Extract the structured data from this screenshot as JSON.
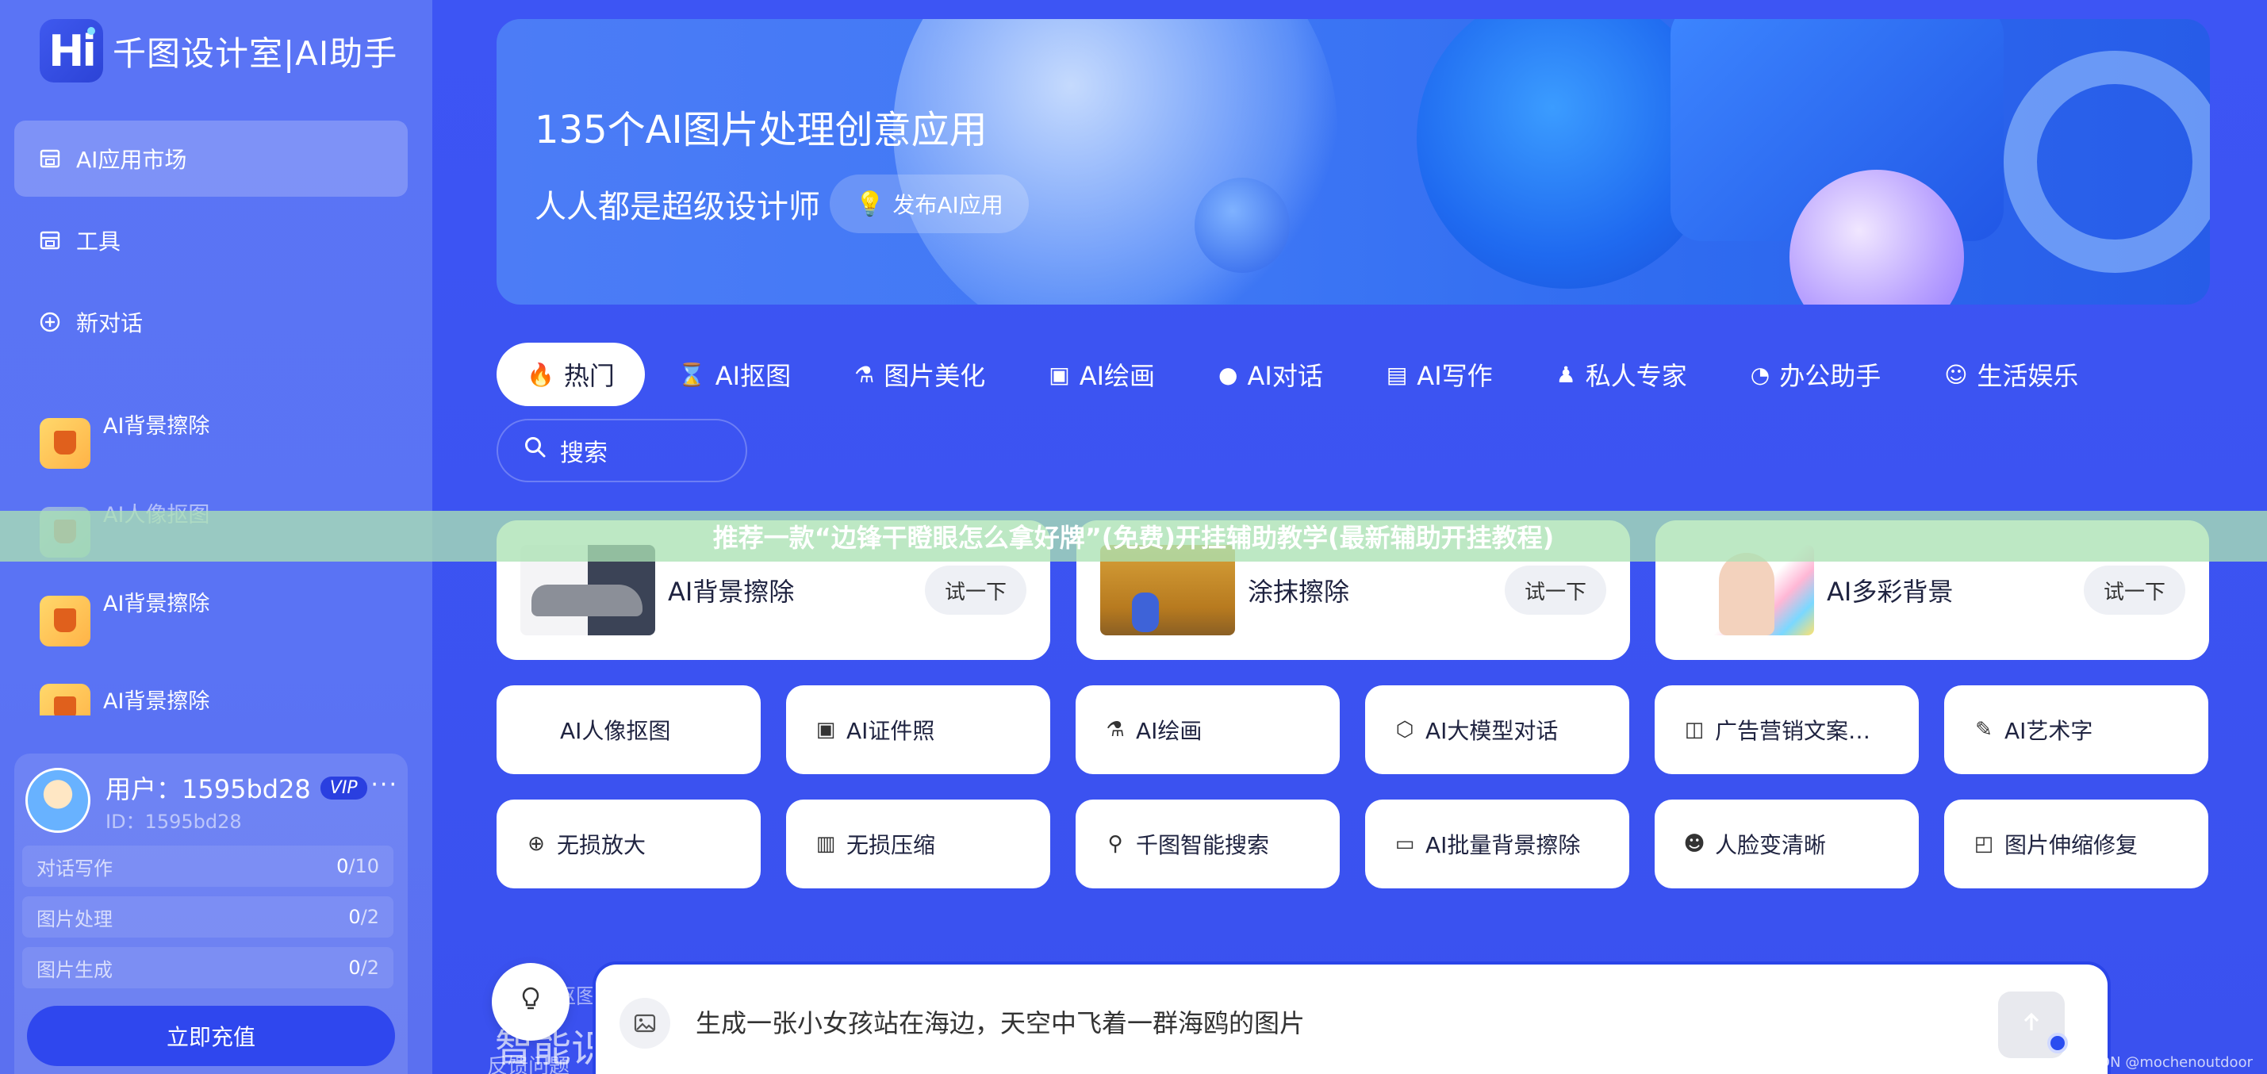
{
  "app": {
    "logo_mark": "Hi",
    "logo_text": "千图设计室|AI助手"
  },
  "sidebar": {
    "nav": [
      {
        "label": "AI应用市场",
        "icon": "store-icon",
        "active": true
      },
      {
        "label": "工具",
        "icon": "store-icon",
        "active": false
      },
      {
        "label": "新对话",
        "icon": "plus-circle-icon",
        "active": false
      }
    ],
    "recent": [
      {
        "label": "AI背景擦除"
      },
      {
        "label": "AI人像抠图"
      },
      {
        "label": "AI背景擦除"
      },
      {
        "label": "AI背景擦除"
      }
    ]
  },
  "user": {
    "name": "用户：1595bd28",
    "vip": "VIP",
    "more": "···",
    "id": "ID：1595bd28",
    "quotas": [
      {
        "label": "对话写作",
        "used": "0",
        "total": "/10"
      },
      {
        "label": "图片处理",
        "used": "0",
        "total": "/2"
      },
      {
        "label": "图片生成",
        "used": "0",
        "total": "/2"
      }
    ],
    "recharge": "立即充值"
  },
  "banner": {
    "title": "135个AI图片处理创意应用",
    "subtitle": "人人都是超级设计师",
    "publish": "发布AI应用"
  },
  "tabs": [
    {
      "label": "热门",
      "icon": "fire-icon",
      "glyph": "🔥",
      "active": true
    },
    {
      "label": "AI抠图",
      "icon": "hourglass-icon",
      "glyph": "⌛",
      "active": false
    },
    {
      "label": "图片美化",
      "icon": "flask-icon",
      "glyph": "⚗",
      "active": false
    },
    {
      "label": "AI绘画",
      "icon": "image-icon",
      "glyph": "▣",
      "active": false
    },
    {
      "label": "AI对话",
      "icon": "chat-icon",
      "glyph": "●",
      "active": false
    },
    {
      "label": "AI写作",
      "icon": "book-icon",
      "glyph": "▤",
      "active": false
    },
    {
      "label": "私人专家",
      "icon": "person-icon",
      "glyph": "♟",
      "active": false
    },
    {
      "label": "办公助手",
      "icon": "dashboard-icon",
      "glyph": "◔",
      "active": false
    },
    {
      "label": "生活娱乐",
      "icon": "smile-icon",
      "glyph": "☺",
      "active": false
    }
  ],
  "search": {
    "label": "搜索"
  },
  "features": [
    {
      "name": "AI背景擦除",
      "try": "试一下"
    },
    {
      "name": "涂抹擦除",
      "try": "试一下"
    },
    {
      "name": "AI多彩背景",
      "try": "试一下"
    }
  ],
  "tools_row1": [
    {
      "label": "AI人像抠图",
      "icon": ""
    },
    {
      "label": "AI证件照",
      "icon": "id-card-icon",
      "glyph": "▣"
    },
    {
      "label": "AI绘画",
      "icon": "flask-icon",
      "glyph": "⚗"
    },
    {
      "label": "AI大模型对话",
      "icon": "hexagon-icon",
      "glyph": "⬡"
    },
    {
      "label": "广告营销文案…",
      "icon": "speaker-icon",
      "glyph": "◫"
    },
    {
      "label": "AI艺术字",
      "icon": "edit-image-icon",
      "glyph": "✎"
    }
  ],
  "tools_row2": [
    {
      "label": "无损放大",
      "icon": "zoom-in-icon",
      "glyph": "⊕"
    },
    {
      "label": "无损压缩",
      "icon": "compress-icon",
      "glyph": "▥"
    },
    {
      "label": "千图智能搜索",
      "icon": "search-icon",
      "glyph": "⚲"
    },
    {
      "label": "AI批量背景擦除",
      "icon": "layers-icon",
      "glyph": "▭"
    },
    {
      "label": "人脸变清晰",
      "icon": "face-icon",
      "glyph": "☻"
    },
    {
      "label": "图片伸缩修复",
      "icon": "crop-icon",
      "glyph": "◰"
    }
  ],
  "overlay_text": "推荐一款“边锋干瞪眼怎么拿好牌”(免费)开挂辅助教学(最新辅助开挂教程)",
  "bottom": {
    "peek1": "抠图",
    "peek2": "智能识",
    "feedback": "反馈问题",
    "chat_placeholder": "生成一张小女孩站在海边，天空中飞着一群海鸥的图片",
    "watermark": "CSDN @mochenoutdoor"
  }
}
